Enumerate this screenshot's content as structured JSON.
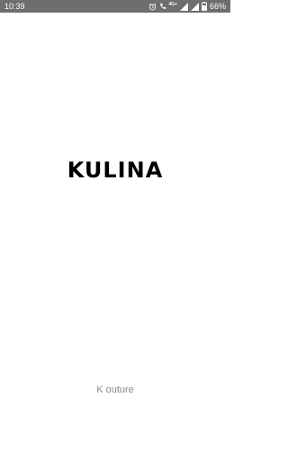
{
  "status_bar": {
    "time": "10:39",
    "network_label": "4G+",
    "battery_percent": "66%",
    "icons": [
      "alarm-icon",
      "call-icon",
      "signal-icon",
      "signal-icon-2",
      "battery-icon"
    ]
  },
  "splash": {
    "brand_name": "KULINA",
    "tagline": "K outure"
  },
  "colors": {
    "status_bar_bg": "#6e6e6e",
    "background": "#ffffff",
    "brand_text": "#000000",
    "tagline_text": "#8a8a8a"
  }
}
